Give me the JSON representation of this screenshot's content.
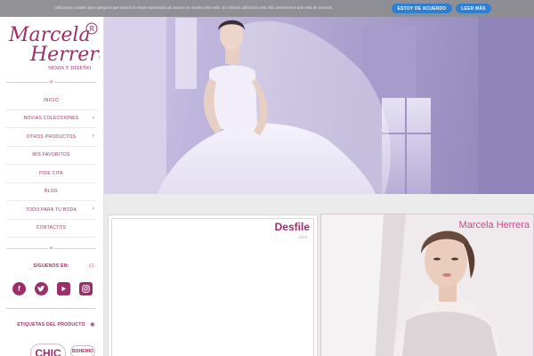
{
  "cookie_bar": {
    "text": "Utilizamos cookies para asegurar que damos la mejor experiencia al usuario en nuestro sitio web. Si continúa utilizando este sitio asumiremos que está de acuerdo.",
    "accept_label": "ESTOY DE ACUERDO",
    "more_label": "LEER MÁS"
  },
  "logo": {
    "name_line1": "Marcela",
    "name_line2": "Herrera",
    "registered": "®",
    "tagline": "MODA Y DISEÑO"
  },
  "menu": [
    {
      "label": "INICIO",
      "has_submenu": false
    },
    {
      "label": "NOVIAS COLECCIONES",
      "has_submenu": true
    },
    {
      "label": "OTROS PRODUCTOS",
      "has_submenu": true
    },
    {
      "label": "MIS FAVORITOS",
      "has_submenu": false
    },
    {
      "label": "PIDE CITA",
      "has_submenu": false
    },
    {
      "label": "BLOG",
      "has_submenu": false
    },
    {
      "label": "TODO PARA TU BODA",
      "has_submenu": true
    },
    {
      "label": "CONTACTOS",
      "has_submenu": false
    }
  ],
  "follow": {
    "title": "SÍGUENOS EN:",
    "networks": [
      "facebook-icon",
      "twitter-icon",
      "youtube-icon",
      "instagram-icon"
    ]
  },
  "tags": {
    "title": "ETIQUETAS DEL PRODUCTO",
    "items": [
      "CHIC",
      "BOHEMIO"
    ]
  },
  "cards": [
    {
      "title": "Desfile",
      "subtitle": "- 2016 -"
    },
    {
      "title": "Marcela Herrera"
    }
  ],
  "colors": {
    "brand": "#9c2f6a",
    "cookie_button": "#2b7fd2",
    "cookie_bar": "#8e8e93"
  }
}
